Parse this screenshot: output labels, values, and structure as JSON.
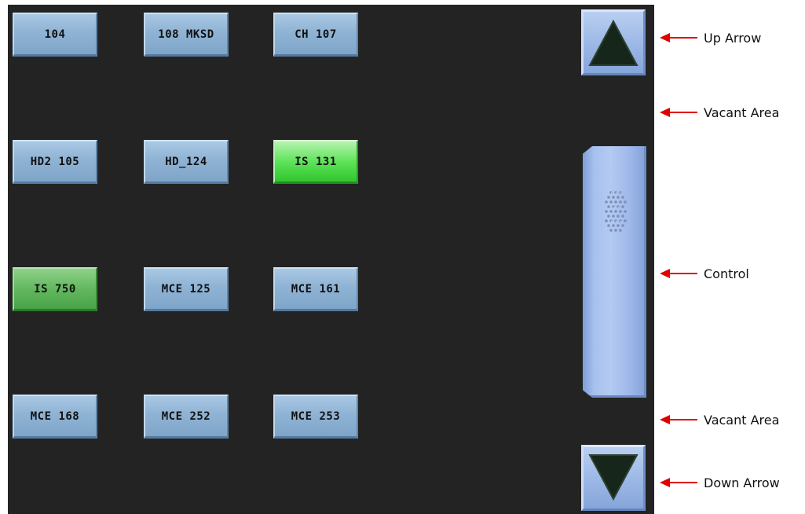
{
  "tiles": [
    {
      "label": "104",
      "state": "normal"
    },
    {
      "label": "108 MKSD",
      "state": "normal"
    },
    {
      "label": "CH 107",
      "state": "normal"
    },
    {
      "label": "HD2 105",
      "state": "normal"
    },
    {
      "label": "HD_124",
      "state": "normal"
    },
    {
      "label": "IS 131",
      "state": "selected-bright"
    },
    {
      "label": "IS 750",
      "state": "selected-dim"
    },
    {
      "label": "MCE 125",
      "state": "normal"
    },
    {
      "label": "MCE 161",
      "state": "normal"
    },
    {
      "label": "MCE 168",
      "state": "normal"
    },
    {
      "label": "MCE 252",
      "state": "normal"
    },
    {
      "label": "MCE 253",
      "state": "normal"
    }
  ],
  "scrollbar": {
    "up_icon": "triangle-up-icon",
    "down_icon": "triangle-down-icon",
    "thumb_icon": "grip-dots-icon"
  },
  "annotations": {
    "up_arrow": "Up Arrow",
    "vacant_top": "Vacant Area",
    "control": "Control",
    "vacant_bottom": "Vacant Area",
    "down_arrow": "Down Arrow"
  },
  "colors": {
    "panel_bg": "#232323",
    "tile_blue": "#8fb3d4",
    "tile_green_bright": "#5fe35a",
    "tile_green_dim": "#62b85f",
    "scrollbar_blue": "#9bb7e6",
    "annotation_arrow": "#e00000"
  }
}
